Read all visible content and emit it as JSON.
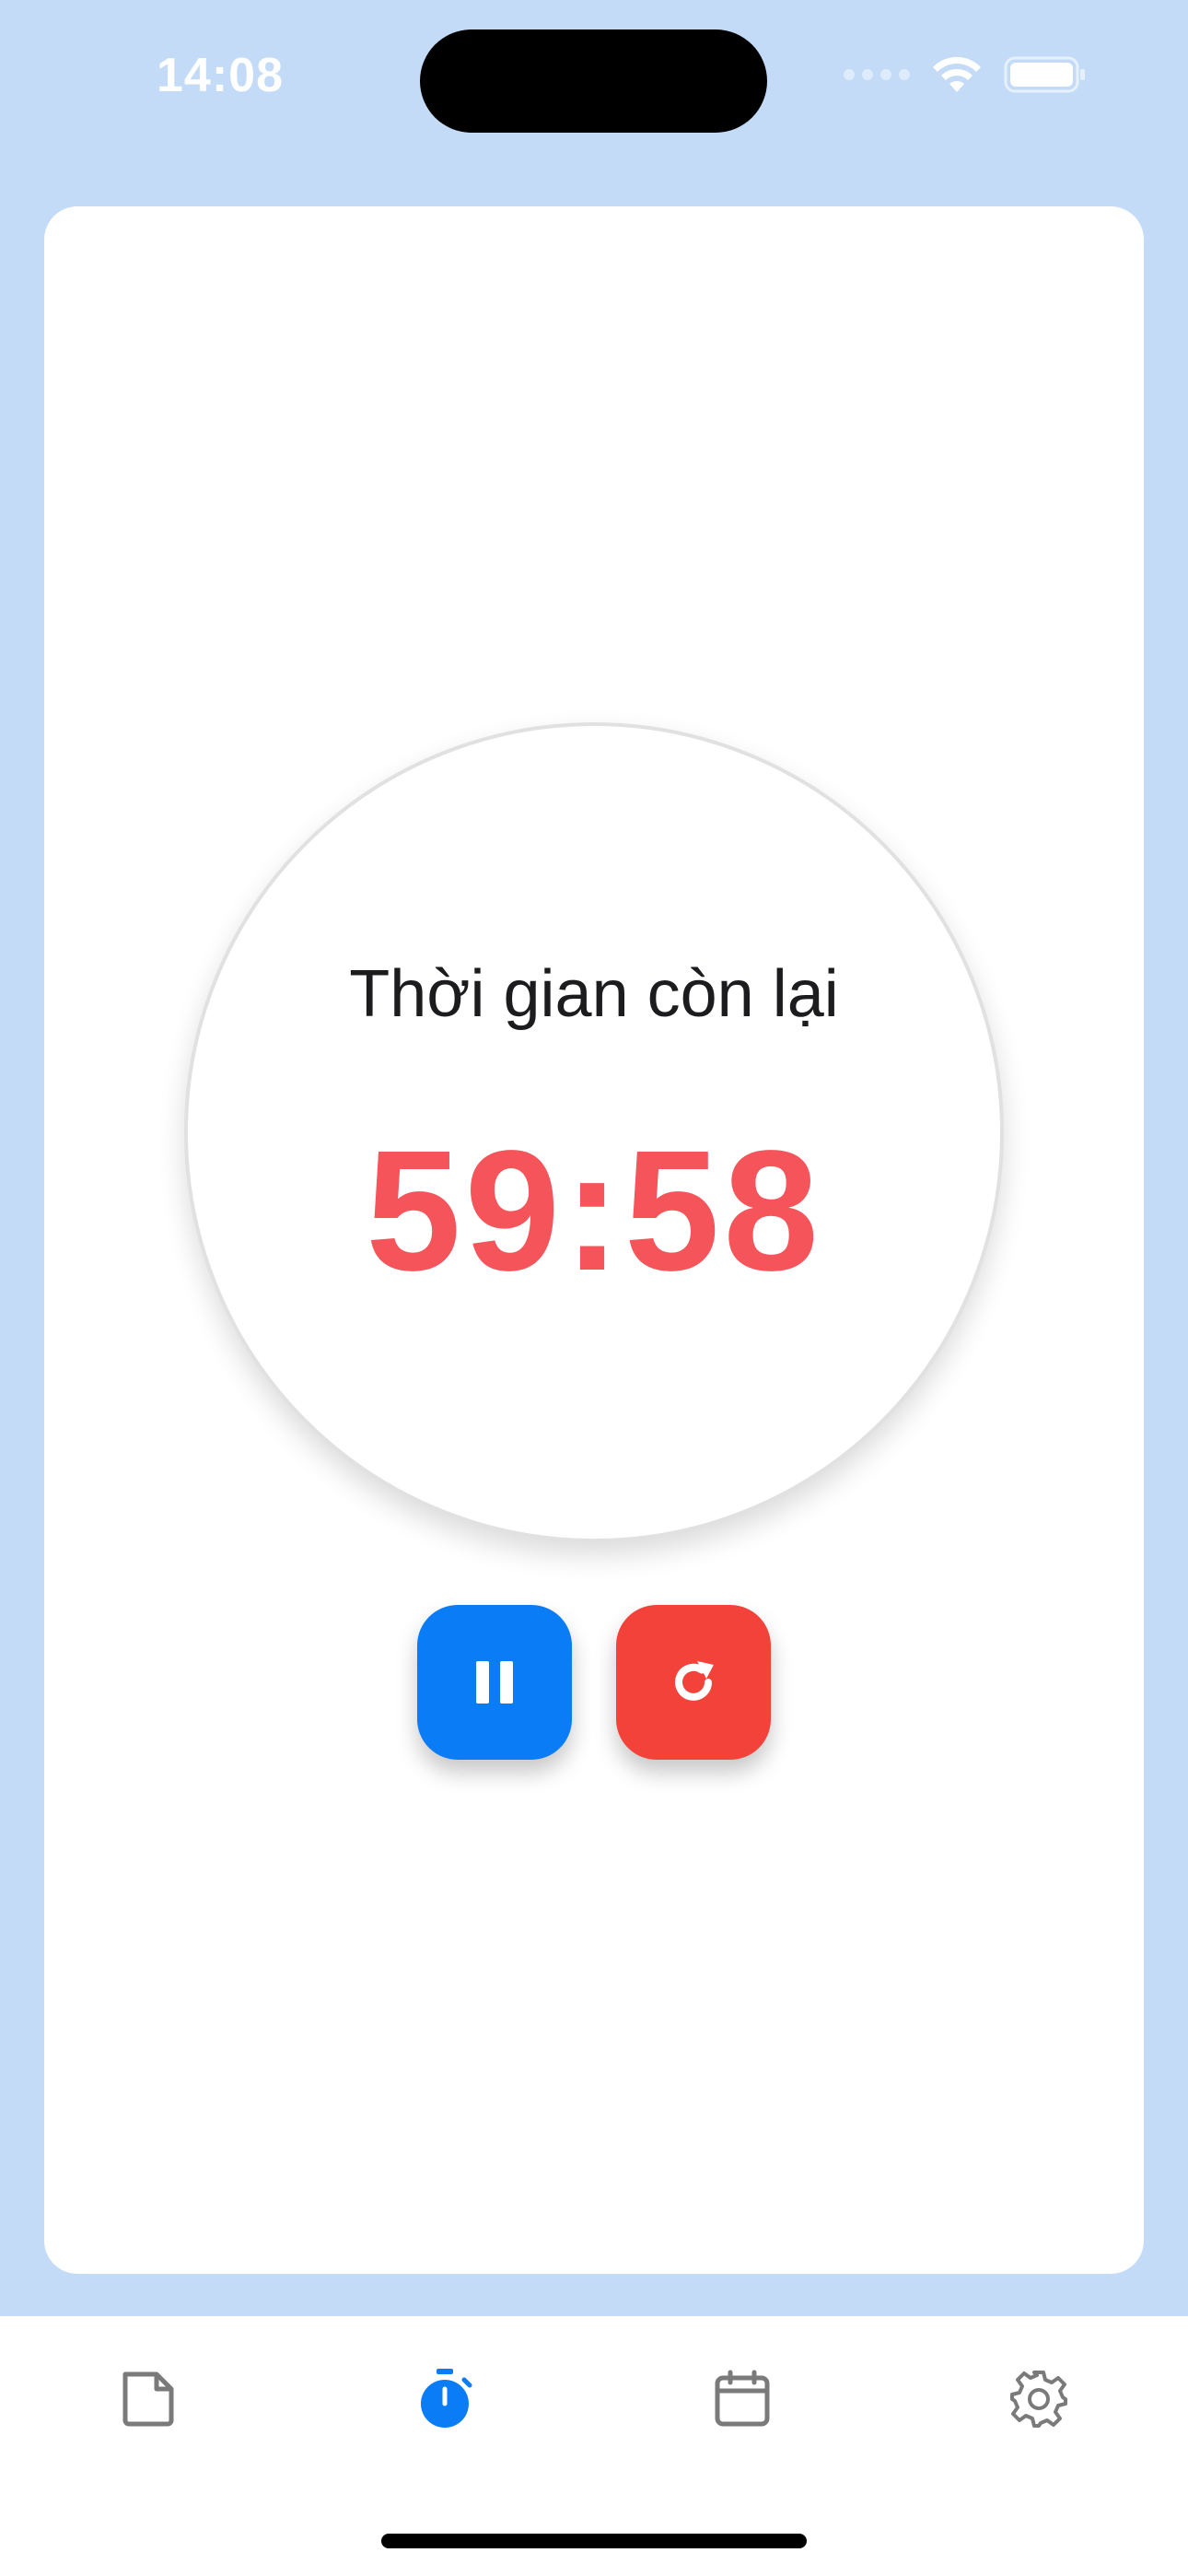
{
  "status_bar": {
    "time": "14:08"
  },
  "timer": {
    "label": "Thời gian còn lại",
    "remaining": "59:58",
    "value_color": "#f4545a"
  },
  "controls": {
    "pause_icon": "pause-icon",
    "reset_icon": "reset-icon",
    "pause_color": "#0a7cf5",
    "reset_color": "#f3423a"
  },
  "tabbar": {
    "tabs": [
      {
        "icon": "document-icon",
        "active": false
      },
      {
        "icon": "stopwatch-icon",
        "active": true
      },
      {
        "icon": "calendar-icon",
        "active": false
      },
      {
        "icon": "gear-icon",
        "active": false
      }
    ],
    "active_color": "#0a7cf5",
    "inactive_color": "#7a7a7a"
  },
  "colors": {
    "background": "#c3dbf7",
    "card": "#ffffff"
  }
}
